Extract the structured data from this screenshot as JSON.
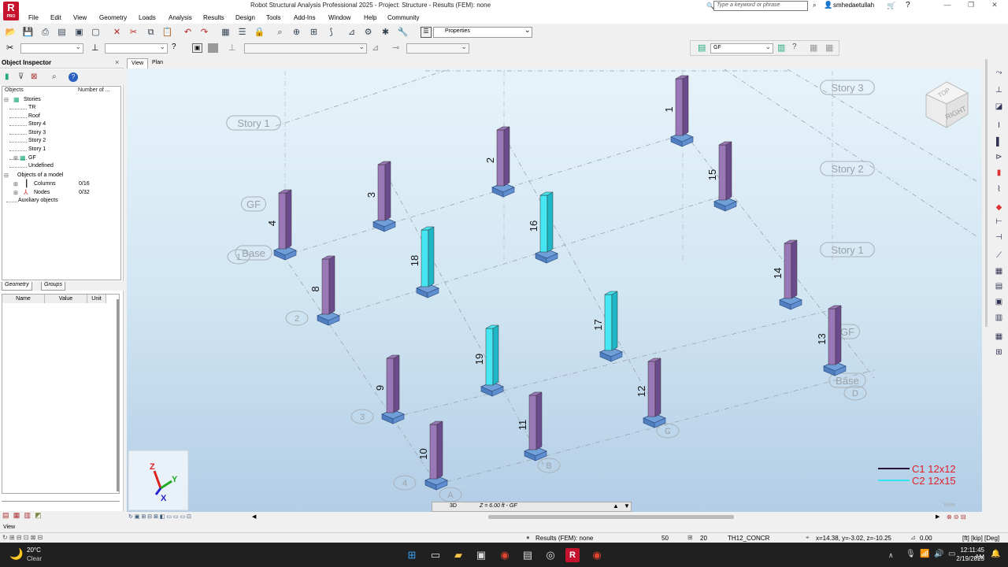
{
  "app": {
    "title": "Robot Structural Analysis Professional 2025 - Project: Structure - Results (FEM): none",
    "icon_letter": "R",
    "icon_sub": "PRO"
  },
  "search": {
    "placeholder": "Type a keyword or phrase"
  },
  "user": {
    "name": "smhedaetullah"
  },
  "menu": [
    "File",
    "Edit",
    "View",
    "Geometry",
    "Loads",
    "Analysis",
    "Results",
    "Design",
    "Tools",
    "Add-Ins",
    "Window",
    "Help",
    "Community"
  ],
  "toolbar": {
    "properties_label": "Properties",
    "story_select": "GF"
  },
  "inspector": {
    "title": "Object Inspector",
    "col_objects": "Objects",
    "col_number": "Number of ...",
    "stories_label": "Stories",
    "stories": [
      "TR",
      "Roof",
      "Story 4",
      "Story 3",
      "Story 2",
      "Story 1",
      "GF",
      "Undefined"
    ],
    "objects_model": "Objects of a model",
    "columns_label": "Columns",
    "columns_count": "0/16",
    "nodes_label": "Nodes",
    "nodes_count": "0/32",
    "aux_label": "Auxiliary objects",
    "tab_geometry": "Geometry",
    "tab_groups": "Groups",
    "grid_name": "Name",
    "grid_value": "Value",
    "grid_unit": "Unit"
  },
  "view_tabs": [
    "View",
    "Plan"
  ],
  "viewport": {
    "story_labels": [
      "Story 3",
      "Story 2",
      "Story 1",
      "GF",
      "Base",
      "Story 1",
      "GF",
      "Base"
    ],
    "grid_labels": [
      "1",
      "2",
      "3",
      "4",
      "A",
      "B",
      "C",
      "D"
    ],
    "column_numbers": [
      "1",
      "2",
      "3",
      "4",
      "8",
      "9",
      "10",
      "11",
      "12",
      "13",
      "14",
      "15",
      "16",
      "17",
      "18",
      "19"
    ],
    "axis": {
      "z": "Z",
      "y": "Y",
      "x": "X"
    },
    "cube": {
      "top": "TOP",
      "right": "RIGHT"
    },
    "legend": [
      {
        "label": "C1 12x12",
        "color": "#2c0f3a"
      },
      {
        "label": "C2 12x15",
        "color": "#35e3f0"
      }
    ],
    "view_watermark": "View",
    "mode_3d": "3D",
    "z_info": "Z = 6.00 ft - GF"
  },
  "status": {
    "view_label": "View",
    "results": "Results (FEM): none",
    "v1": "50",
    "v2": "20",
    "material": "TH12_CONCR",
    "coords": "x=14.38, y=-3.02, z=-10.25",
    "value": "0.00",
    "units": "[ft] [kip] [Deg]"
  },
  "taskbar": {
    "temp": "20°C",
    "weather": "Clear",
    "time": "12:11:45 AM",
    "date": "2/19/2025"
  },
  "colors": {
    "purple_column": "#9a78b8",
    "cyan_column": "#46e6f2",
    "footing": "#6f9ed8"
  }
}
